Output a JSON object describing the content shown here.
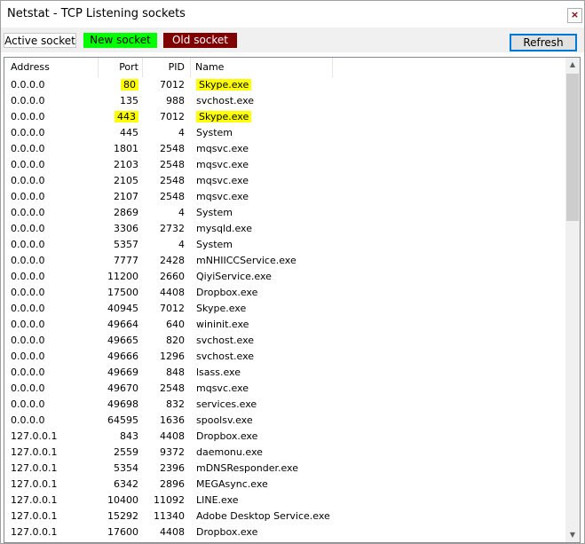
{
  "window": {
    "title": "Netstat - TCP Listening sockets",
    "close_label": "×"
  },
  "legend": {
    "active": "Active socket",
    "new": "New socket",
    "old": "Old socket"
  },
  "toolbar": {
    "refresh_label": "Refresh"
  },
  "colors": {
    "new_socket": "#00ff00",
    "old_socket": "#800000",
    "highlight": "#ffff00",
    "refresh_border": "#0078d7"
  },
  "table": {
    "columns": [
      "Address",
      "Port",
      "PID",
      "Name"
    ],
    "rows": [
      {
        "address": "0.0.0.0",
        "port": "80",
        "pid": "7012",
        "name": "Skype.exe",
        "highlight_port": true,
        "highlight_name": true
      },
      {
        "address": "0.0.0.0",
        "port": "135",
        "pid": "988",
        "name": "svchost.exe"
      },
      {
        "address": "0.0.0.0",
        "port": "443",
        "pid": "7012",
        "name": "Skype.exe",
        "highlight_port": true,
        "highlight_name": true
      },
      {
        "address": "0.0.0.0",
        "port": "445",
        "pid": "4",
        "name": "System"
      },
      {
        "address": "0.0.0.0",
        "port": "1801",
        "pid": "2548",
        "name": "mqsvc.exe"
      },
      {
        "address": "0.0.0.0",
        "port": "2103",
        "pid": "2548",
        "name": "mqsvc.exe"
      },
      {
        "address": "0.0.0.0",
        "port": "2105",
        "pid": "2548",
        "name": "mqsvc.exe"
      },
      {
        "address": "0.0.0.0",
        "port": "2107",
        "pid": "2548",
        "name": "mqsvc.exe"
      },
      {
        "address": "0.0.0.0",
        "port": "2869",
        "pid": "4",
        "name": "System"
      },
      {
        "address": "0.0.0.0",
        "port": "3306",
        "pid": "2732",
        "name": "mysqld.exe"
      },
      {
        "address": "0.0.0.0",
        "port": "5357",
        "pid": "4",
        "name": "System"
      },
      {
        "address": "0.0.0.0",
        "port": "7777",
        "pid": "2428",
        "name": "mNHIICCService.exe"
      },
      {
        "address": "0.0.0.0",
        "port": "11200",
        "pid": "2660",
        "name": "QiyiService.exe"
      },
      {
        "address": "0.0.0.0",
        "port": "17500",
        "pid": "4408",
        "name": "Dropbox.exe"
      },
      {
        "address": "0.0.0.0",
        "port": "40945",
        "pid": "7012",
        "name": "Skype.exe"
      },
      {
        "address": "0.0.0.0",
        "port": "49664",
        "pid": "640",
        "name": "wininit.exe"
      },
      {
        "address": "0.0.0.0",
        "port": "49665",
        "pid": "820",
        "name": "svchost.exe"
      },
      {
        "address": "0.0.0.0",
        "port": "49666",
        "pid": "1296",
        "name": "svchost.exe"
      },
      {
        "address": "0.0.0.0",
        "port": "49669",
        "pid": "848",
        "name": "lsass.exe"
      },
      {
        "address": "0.0.0.0",
        "port": "49670",
        "pid": "2548",
        "name": "mqsvc.exe"
      },
      {
        "address": "0.0.0.0",
        "port": "49698",
        "pid": "832",
        "name": "services.exe"
      },
      {
        "address": "0.0.0.0",
        "port": "64595",
        "pid": "1636",
        "name": "spoolsv.exe"
      },
      {
        "address": "127.0.0.1",
        "port": "843",
        "pid": "4408",
        "name": "Dropbox.exe"
      },
      {
        "address": "127.0.0.1",
        "port": "2559",
        "pid": "9372",
        "name": "daemonu.exe"
      },
      {
        "address": "127.0.0.1",
        "port": "5354",
        "pid": "2396",
        "name": "mDNSResponder.exe"
      },
      {
        "address": "127.0.0.1",
        "port": "6342",
        "pid": "2896",
        "name": "MEGAsync.exe"
      },
      {
        "address": "127.0.0.1",
        "port": "10400",
        "pid": "11092",
        "name": "LINE.exe"
      },
      {
        "address": "127.0.0.1",
        "port": "15292",
        "pid": "11340",
        "name": "Adobe Desktop Service.exe"
      },
      {
        "address": "127.0.0.1",
        "port": "17600",
        "pid": "4408",
        "name": "Dropbox.exe"
      }
    ]
  }
}
